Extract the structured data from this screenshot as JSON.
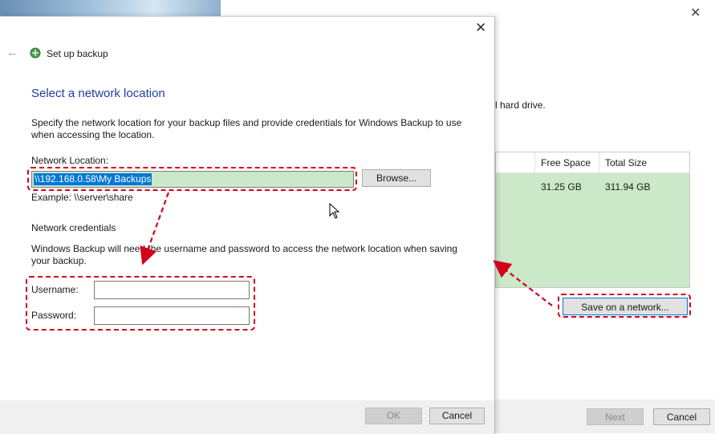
{
  "background_window": {
    "partial_text": "l hard drive.",
    "table": {
      "columns": [
        "Free Space",
        "Total Size"
      ],
      "row": {
        "free_space": "31.25 GB",
        "total_size": "311.94 GB"
      }
    },
    "save_on_network_label": "Save on a network...",
    "next_label": "Next",
    "cancel_label": "Cancel",
    "close_icon": "close-icon"
  },
  "dialog": {
    "title": "Set up backup",
    "close_icon": "close-icon",
    "back_icon": "back-arrow-icon",
    "heading": "Select a network location",
    "description": "Specify the network location for your backup files and provide credentials for Windows Backup to use when accessing the location.",
    "network_location_label": "Network Location:",
    "network_location_value": "\\\\192.168.0.58\\My Backups",
    "browse_label": "Browse...",
    "example": "Example: \\\\server\\share",
    "credentials_heading": "Network credentials",
    "credentials_description": "Windows Backup will need the username and password to access the network location when saving your backup.",
    "username_label": "Username:",
    "password_label": "Password:",
    "username_value": "",
    "password_value": "",
    "ok_label": "OK",
    "cancel_label": "Cancel"
  },
  "colors": {
    "accent": "#0078d7",
    "heading": "#1f3f9f",
    "highlight_annotation": "#d0021b",
    "selection_green": "#cbe8c8"
  }
}
